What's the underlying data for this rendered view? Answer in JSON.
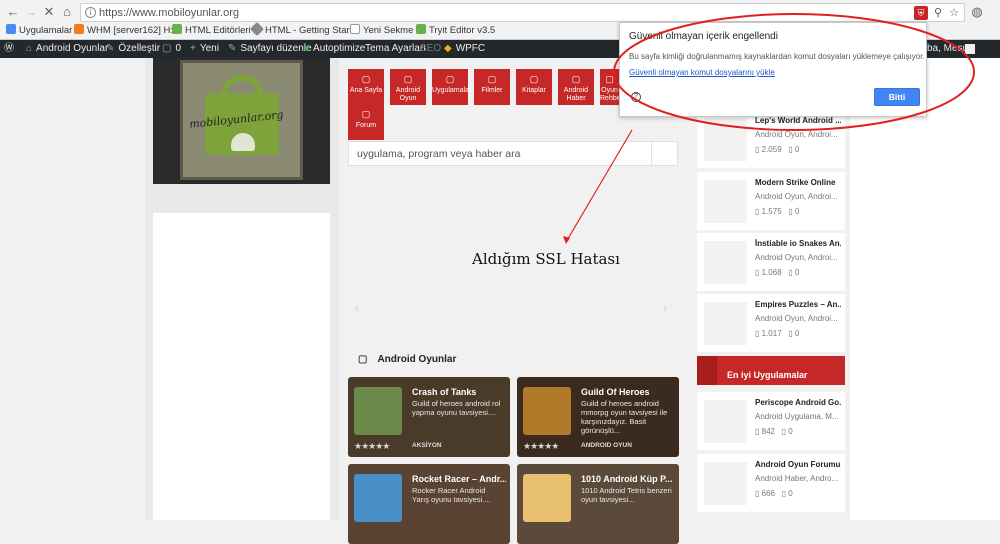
{
  "browser": {
    "url": "https://www.mobiloyunlar.org",
    "bookmarks": [
      "Uygulamalar",
      "WHM [server162] H:",
      "HTML Editörleri",
      "HTML - Getting Star",
      "Yeni Sekme",
      "Tryit Editor v3.5"
    ]
  },
  "wp_bar": {
    "items": [
      "Android Oyunlar",
      "Özelleştir",
      "0",
      "Yeni",
      "Sayfayı düzenle",
      "Autoptimize",
      "Tema Ayarları",
      "SEO",
      "WPFC"
    ],
    "greeting": "ba, Mesut"
  },
  "popup": {
    "title": "Güvenli olmayan içerik engellendi",
    "body": "Bu sayfa kimliği doğrulanmamış kaynaklardan komut dosyaları yüklemeye çalışıyor.",
    "link": "Güvenli olmayan komut dosyalarını yükle",
    "button": "Bitti"
  },
  "logo": {
    "text": "mobiloyunlar.org"
  },
  "menu": {
    "items": [
      "Ana Sayfa",
      "Android Oyun",
      "Uygulamalar",
      "Filmler",
      "Kitaplar",
      "Android Haber",
      "Oyun Rehberi"
    ],
    "forum": "Forum"
  },
  "search": {
    "placeholder": "uygulama, program veya haber ara"
  },
  "annotation": "Aldığım SSL Hatası",
  "section": {
    "title": "Android Oyunlar"
  },
  "cards": [
    {
      "title": "Crash of Tanks",
      "desc": "Guild of heroes android rol yapma oyunu tavsiyesi....",
      "cat": "AKSİYON"
    },
    {
      "title": "Guild Of Heroes",
      "desc": "Guild of heroes android mmorpg oyun tavsiyesi ile karşınızdayız. Basit görünüşlü...",
      "cat": "ANDROID OYUN"
    },
    {
      "title": "Rocket Racer – Andr...",
      "desc": "Rocker Racer Android Yarış oyunu tavsiyesi....",
      "cat": ""
    },
    {
      "title": "1010 Android Küp P...",
      "desc": "1010 Android Tetris benzeri oyun tavsiyesi...",
      "cat": ""
    }
  ],
  "sidebar": {
    "items": [
      {
        "title": "Lep's World Android ...",
        "cat": "Android Oyun, Androi...",
        "views": "2.059",
        "comments": "0"
      },
      {
        "title": "Modern Strike Online",
        "cat": "Android Oyun, Androi...",
        "views": "1.575",
        "comments": "0"
      },
      {
        "title": "İnstiable io Snakes An...",
        "cat": "Android Oyun, Androi...",
        "views": "1.068",
        "comments": "0"
      },
      {
        "title": "Empires Puzzles – An...",
        "cat": "Android Oyun, Androi...",
        "views": "1.017",
        "comments": "0"
      }
    ],
    "best_header": "En iyi Uygulamalar",
    "best": [
      {
        "title": "Periscope Android Go...",
        "cat": "Android Uygulama, M...",
        "views": "842",
        "comments": "0"
      },
      {
        "title": "Android Oyun Forumu...",
        "cat": "Android Haber, Andro...",
        "views": "666",
        "comments": "0"
      }
    ]
  }
}
